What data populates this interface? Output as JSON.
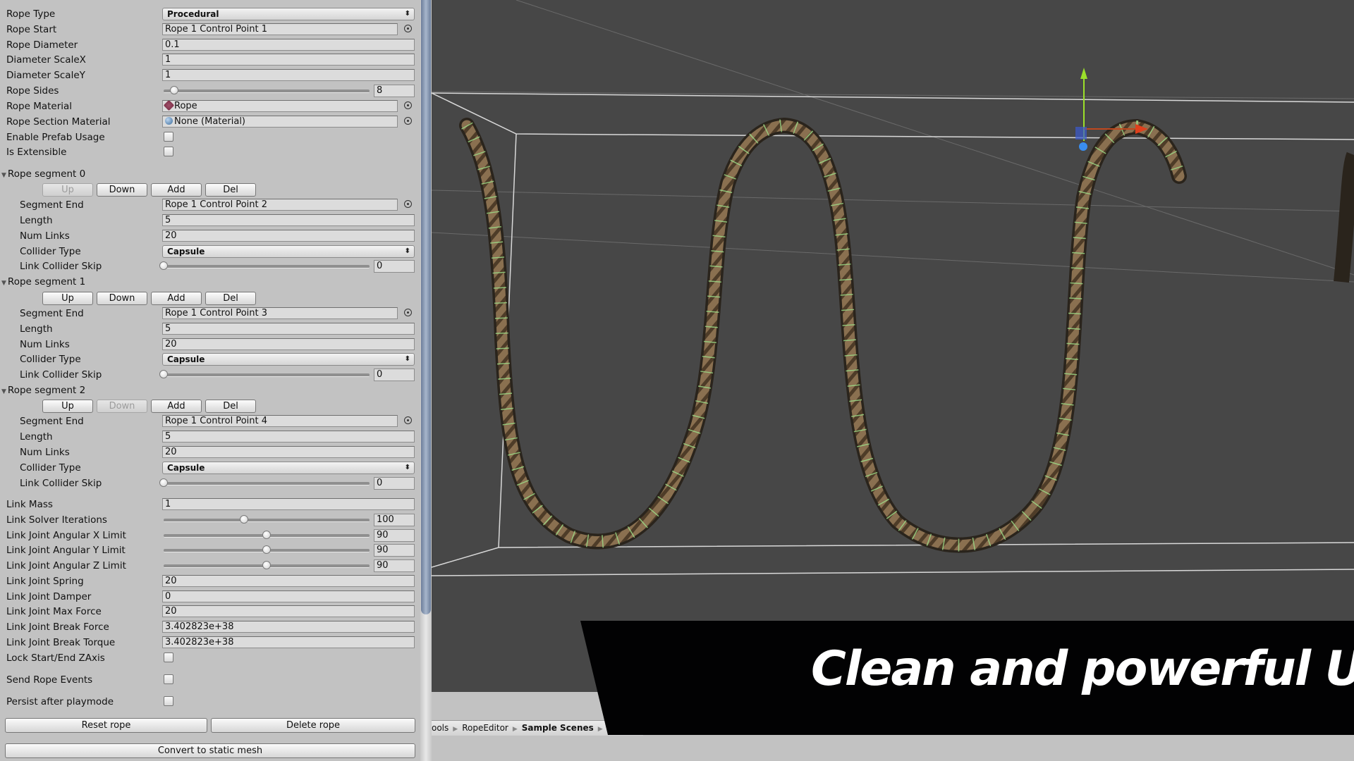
{
  "inspector": {
    "rope_type": {
      "label": "Rope Type",
      "value": "Procedural"
    },
    "rope_start": {
      "label": "Rope Start",
      "value": "Rope 1 Control Point 1"
    },
    "rope_diameter": {
      "label": "Rope Diameter",
      "value": "0.1"
    },
    "diameter_scale_x": {
      "label": "Diameter ScaleX",
      "value": "1"
    },
    "diameter_scale_y": {
      "label": "Diameter ScaleY",
      "value": "1"
    },
    "rope_sides": {
      "label": "Rope Sides",
      "value": "8",
      "slider_fraction": 0.05
    },
    "rope_material": {
      "label": "Rope Material",
      "value": "Rope",
      "icon": "material-x-icon"
    },
    "rope_section_material": {
      "label": "Rope Section Material",
      "value": "None (Material)",
      "icon": "material-sphere-icon"
    },
    "enable_prefab_usage": {
      "label": "Enable Prefab Usage",
      "checked": false
    },
    "is_extensible": {
      "label": "Is Extensible",
      "checked": false
    },
    "segments": [
      {
        "title": "Rope segment 0",
        "buttons": {
          "up": "Up",
          "down": "Down",
          "add": "Add",
          "del": "Del"
        },
        "up_disabled": true,
        "down_disabled": false,
        "segment_end": {
          "label": "Segment End",
          "value": "Rope 1 Control Point 2"
        },
        "length": {
          "label": "Length",
          "value": "5"
        },
        "num_links": {
          "label": "Num Links",
          "value": "20"
        },
        "collider_type": {
          "label": "Collider Type",
          "value": "Capsule"
        },
        "link_collider_skip": {
          "label": "Link Collider Skip",
          "value": "0",
          "slider_fraction": 0
        }
      },
      {
        "title": "Rope segment 1",
        "buttons": {
          "up": "Up",
          "down": "Down",
          "add": "Add",
          "del": "Del"
        },
        "up_disabled": false,
        "down_disabled": false,
        "segment_end": {
          "label": "Segment End",
          "value": "Rope 1 Control Point 3"
        },
        "length": {
          "label": "Length",
          "value": "5"
        },
        "num_links": {
          "label": "Num Links",
          "value": "20"
        },
        "collider_type": {
          "label": "Collider Type",
          "value": "Capsule"
        },
        "link_collider_skip": {
          "label": "Link Collider Skip",
          "value": "0",
          "slider_fraction": 0
        }
      },
      {
        "title": "Rope segment 2",
        "buttons": {
          "up": "Up",
          "down": "Down",
          "add": "Add",
          "del": "Del"
        },
        "up_disabled": false,
        "down_disabled": true,
        "segment_end": {
          "label": "Segment End",
          "value": "Rope 1 Control Point 4"
        },
        "length": {
          "label": "Length",
          "value": "5"
        },
        "num_links": {
          "label": "Num Links",
          "value": "20"
        },
        "collider_type": {
          "label": "Collider Type",
          "value": "Capsule"
        },
        "link_collider_skip": {
          "label": "Link Collider Skip",
          "value": "0",
          "slider_fraction": 0
        }
      }
    ],
    "link_mass": {
      "label": "Link Mass",
      "value": "1"
    },
    "link_solver_iterations": {
      "label": "Link Solver Iterations",
      "value": "100",
      "slider_fraction": 0.39
    },
    "link_joint_angular_x": {
      "label": "Link Joint Angular X Limit",
      "value": "90",
      "slider_fraction": 0.5
    },
    "link_joint_angular_y": {
      "label": "Link Joint Angular Y Limit",
      "value": "90",
      "slider_fraction": 0.5
    },
    "link_joint_angular_z": {
      "label": "Link Joint Angular Z Limit",
      "value": "90",
      "slider_fraction": 0.5
    },
    "link_joint_spring": {
      "label": "Link Joint Spring",
      "value": "20"
    },
    "link_joint_damper": {
      "label": "Link Joint Damper",
      "value": "0"
    },
    "link_joint_max_force": {
      "label": "Link Joint Max Force",
      "value": "20"
    },
    "link_joint_break_force": {
      "label": "Link Joint Break Force",
      "value": "3.402823e+38"
    },
    "link_joint_break_torque": {
      "label": "Link Joint Break Torque",
      "value": "3.402823e+38"
    },
    "lock_start_end_zaxis": {
      "label": "Lock Start/End ZAxis",
      "checked": false
    },
    "send_rope_events": {
      "label": "Send Rope Events",
      "checked": false
    },
    "persist_after_playmode": {
      "label": "Persist after playmode",
      "checked": false
    },
    "buttons": {
      "reset_rope": "Reset rope",
      "delete_rope": "Delete rope",
      "convert_static": "Convert to static mesh"
    }
  },
  "breadcrumb": {
    "items": [
      "ools",
      "RopeEditor",
      "Sample Scenes"
    ]
  },
  "banner": {
    "text": "Clean and powerful UI"
  },
  "colors": {
    "inspector_bg": "#c2c2c2",
    "viewport_bg": "#474747",
    "rope": "#8a7050",
    "wire": "#9ee08a",
    "gizmo_x": "#e0401c",
    "gizmo_y": "#9be02a",
    "gizmo_z": "#3a8ef0"
  }
}
